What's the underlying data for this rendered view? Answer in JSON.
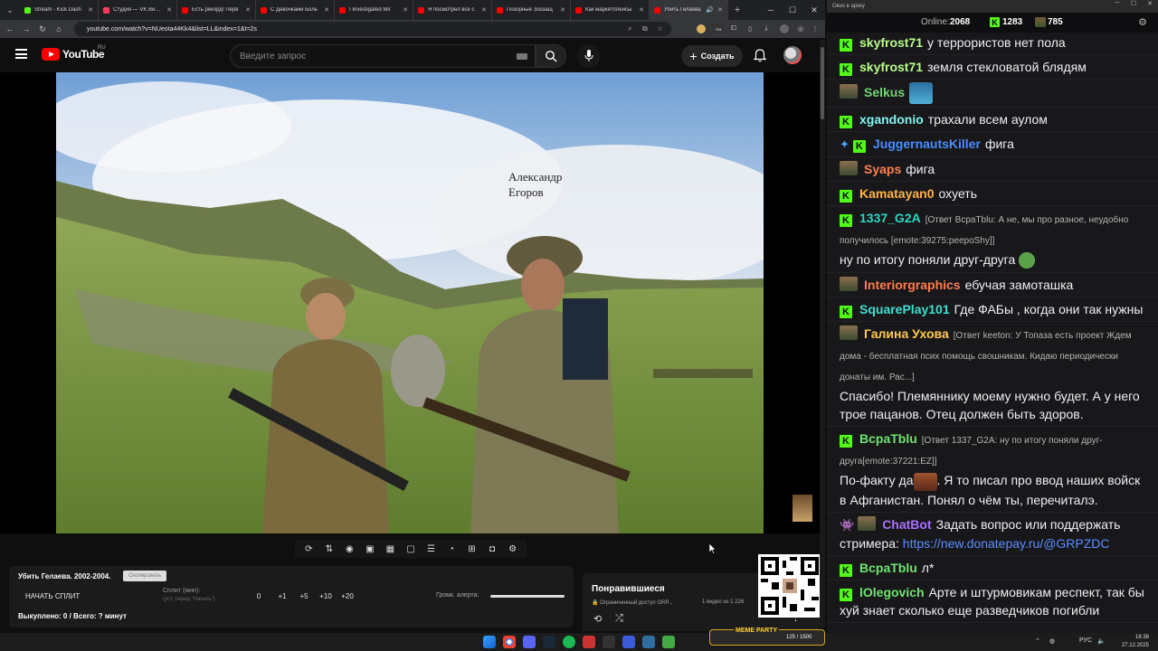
{
  "browser": {
    "tabs": [
      {
        "title": "Stream - Kick Dash",
        "color": "#53fc18",
        "active": false
      },
      {
        "title": "Студия — VK Видео",
        "color": "#ff3b5c",
        "active": false
      },
      {
        "title": "Есть рекорд! Перв",
        "color": "#ff0000",
        "active": false
      },
      {
        "title": "С Девочками Боль",
        "color": "#ff0000",
        "active": false
      },
      {
        "title": "I Investigated Mir",
        "color": "#ff0000",
        "active": false
      },
      {
        "title": "Я посмотрел все с",
        "color": "#ff0000",
        "active": false
      },
      {
        "title": "Позорные Зоозащ",
        "color": "#ff0000",
        "active": false
      },
      {
        "title": "Как маркетплейсы",
        "color": "#ff0000",
        "active": false
      },
      {
        "title": "Убить Гелаева",
        "color": "#ff0000",
        "active": true
      }
    ],
    "url": "youtube.com/watch?v=NUeota44Kk4&list=LL&index=1&t=2s",
    "ext_badge": "724"
  },
  "youtube": {
    "logo_text": "YouTube",
    "region": "RU",
    "search_placeholder": "Введите запрос",
    "create_label": "Создать"
  },
  "video": {
    "caption_line1": "Александр",
    "caption_line2": "Егоров"
  },
  "split_panel": {
    "title": "Убить Гелаева. 2002-2004.",
    "copy_label": "Скопировать",
    "start_label": "НАЧАТЬ СПЛИТ",
    "split_label": "Сплит (мин):",
    "split_hint": "(уст. перед \"Начать\")",
    "values": [
      "0",
      "+1",
      "+5",
      "+10",
      "+20"
    ],
    "alert_label": "Громк. алерта:",
    "total": "Выкуплено: 0 / Всего: ? минут"
  },
  "liked": {
    "title": "Понравившиеся",
    "access": "Ограниченный доступ GRP...",
    "count": "1 видео из 1 226"
  },
  "chat": {
    "window_title": "Окно в архку",
    "online_label": "Online:",
    "online_count": "2068",
    "stat1": "1283",
    "stat2": "785",
    "messages": [
      {
        "user": "skyfrost71",
        "color": "#b6ff8a",
        "text": "у террористов нет пола"
      },
      {
        "user": "skyfrost71",
        "color": "#b6ff8a",
        "text": "земля стекловатой блядям"
      },
      {
        "user": "Selkus",
        "color": "#6fd36f",
        "text": ""
      },
      {
        "user": "xgandonio",
        "color": "#7ff5f0",
        "text": "трахали всем аулом"
      },
      {
        "user": "JuggernautsKiller",
        "color": "#4a8cff",
        "text": "фига"
      },
      {
        "user": "Syaps",
        "color": "#ff7f50",
        "text": "фига"
      },
      {
        "user": "Kamatayan0",
        "color": "#ffb347",
        "text": "охуеть"
      },
      {
        "user": "1337_G2A",
        "color": "#2ad6c2",
        "reply": "[Ответ ВсраТblu: А не, мы про разное, неудобно получилось [emote:39275:peepoShy]]",
        "text": "ну по итогу поняли друг-друга"
      },
      {
        "user": "Interiorgraphics",
        "color": "#ff7b52",
        "text": "ебучая замоташка"
      },
      {
        "user": "SquarePlay101",
        "color": "#3fe0d0",
        "text": "Где ФАБы , когда они так нужны"
      },
      {
        "user": "Галина Ухова",
        "color": "#ffc94d",
        "reply": "[Ответ keeton: У Топаза есть проект Ждем дома - бесплатная псих помощь свошникам. Кидаю периодически донаты им. Рас...]",
        "text": "Спасибо! Племяннику моему нужно будет. А у него трое пацанов. Отец должен быть здоров."
      },
      {
        "user": "ВсраТblu",
        "color": "#6fe36f",
        "reply": "[Ответ 1337_G2A: ну по итогу поняли друг-друга[emote:37221:EZ]]",
        "text_a": "По-факту да",
        "text_b": ". Я то писал про ввод наших войск в Афганистан. Понял о чём ты, перечиталэ."
      },
      {
        "user": "ChatBot",
        "color": "#a970ff",
        "text": "Задать вопрос или поддержать стримера:",
        "link": "https://new.donatepay.ru/@GRPZDC"
      },
      {
        "user": "ВсраТblu",
        "color": "#6fe36f",
        "text": "л*"
      },
      {
        "user": "lOlegovich",
        "color": "#6fe36f",
        "text": "Арте и штурмовикам респект, так бы хуй знает сколько еще разведчиков погибли"
      }
    ]
  },
  "taskbar": {
    "meme_label": "MEME PARTY",
    "meme_count": "125 / 1500",
    "lang": "РУС",
    "time": "18:38",
    "date": "27.12.2025"
  }
}
